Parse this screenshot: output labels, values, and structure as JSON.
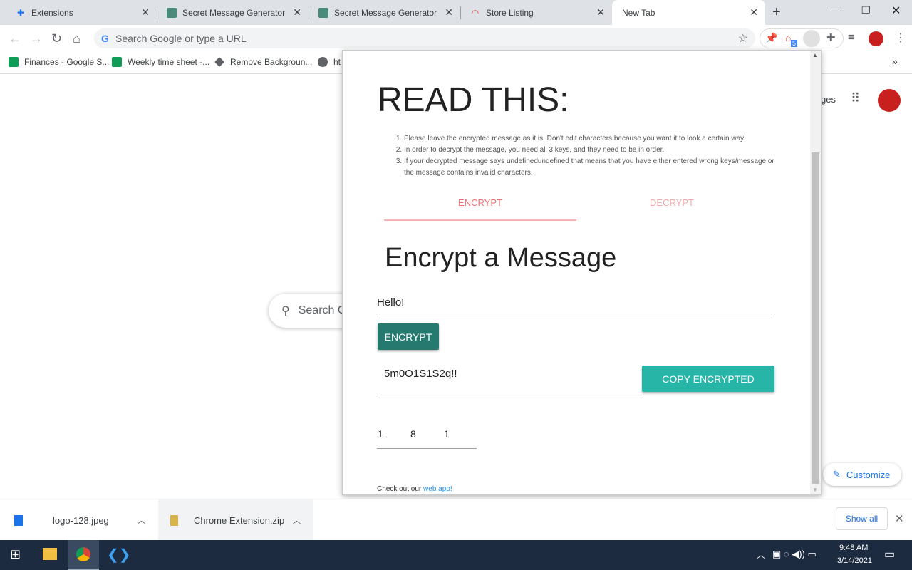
{
  "browser": {
    "tabs": [
      {
        "label": "Extensions",
        "icon": "puzzle-icon"
      },
      {
        "label": "Secret Message Generator",
        "icon": "app-icon"
      },
      {
        "label": "Secret Message Generator",
        "icon": "app-icon"
      },
      {
        "label": "Store Listing",
        "icon": "rainbow-icon"
      },
      {
        "label": "New Tab",
        "icon": "none",
        "active": true
      }
    ],
    "omnibox_placeholder": "Search Google or type a URL",
    "extension_badge": "5",
    "bookmarks": [
      {
        "label": "Finances - Google S...",
        "icon": "sheets-icon"
      },
      {
        "label": "Weekly time sheet -...",
        "icon": "sheets-icon"
      },
      {
        "label": "Remove Backgroun...",
        "icon": "layers-icon"
      },
      {
        "label": "ht",
        "icon": "globe-icon"
      }
    ],
    "bookmarks_overflow": "»"
  },
  "newtab": {
    "search_placeholder": "Search G",
    "images_partial": "ges",
    "customize": "Customize"
  },
  "popup": {
    "heading": "READ THIS:",
    "rules": [
      "Please leave the encrypted message as it is. Don't edit characters because you want it to look a certain way.",
      "In order to decrypt the message, you need all 3 keys, and they need to be in order.",
      "If your decrypted message says undefinedundefined that means that you have either entered wrong keys/message or the message contains invalid characters."
    ],
    "tabs": [
      "ENCRYPT",
      "DECRYPT"
    ],
    "active_tab": "ENCRYPT",
    "title": "Encrypt a Message",
    "message_value": "Hello!",
    "encrypt_button": "ENCRYPT",
    "encrypted_value": "5m0O1S1S2q!!",
    "copy_button": "COPY ENCRYPTED",
    "keys": [
      "1",
      "8",
      "1"
    ],
    "footer_text": "Check out our ",
    "footer_link": "web app!",
    "colors": {
      "accent": "#ee6e73",
      "button_dark": "#26796e",
      "button_teal": "#26b5a6",
      "link": "#2196f3"
    }
  },
  "downloads": {
    "items": [
      {
        "name": "logo-128.jpeg"
      },
      {
        "name": "Chrome Extension.zip"
      }
    ],
    "show_all": "Show all"
  },
  "taskbar": {
    "time": "9:48 AM",
    "date": "3/14/2021"
  }
}
